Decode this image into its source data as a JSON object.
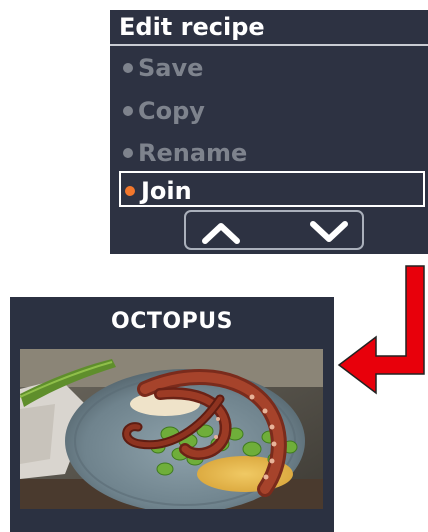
{
  "menu": {
    "title": "Edit recipe",
    "items": [
      {
        "label": "Save",
        "state": "disabled"
      },
      {
        "label": "Copy",
        "state": "disabled"
      },
      {
        "label": "Rename",
        "state": "disabled"
      },
      {
        "label": "Join",
        "state": "selected"
      }
    ],
    "nav": {
      "up_icon": "chevron-up-icon",
      "down_icon": "chevron-down-icon"
    },
    "colors": {
      "panel_bg": "#2d3242",
      "disabled_text": "#7e838d",
      "selected_bullet": "#f2772c",
      "text": "#ffffff"
    }
  },
  "pointer_arrow": {
    "icon": "red-elbow-arrow-icon",
    "color": "#e8000b"
  },
  "recipe": {
    "title": "OCTOPUS",
    "photo": "octopus-dish-photo"
  }
}
